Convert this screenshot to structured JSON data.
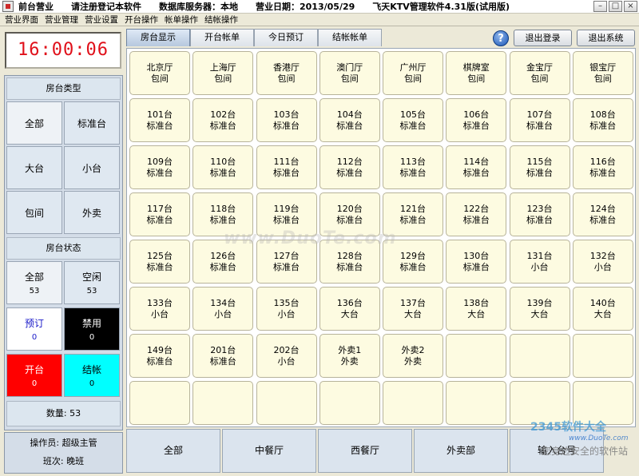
{
  "titlebar": {
    "segments": [
      "前台营业",
      "请注册登记本软件",
      "数据库服务器：本地",
      "营业日期：2013/05/29",
      "飞天KTV管理软件4.31版(试用版)"
    ]
  },
  "menu": [
    "营业界面",
    "营业管理",
    "营业设置",
    "开台操作",
    "帐单操作",
    "结帐操作"
  ],
  "clock": "16:00:06",
  "room_type": {
    "header": "房台类型",
    "buttons": [
      "全部",
      "标准台",
      "大台",
      "小台",
      "包间",
      "外卖"
    ]
  },
  "room_status": {
    "header": "房台状态",
    "buttons": [
      {
        "label": "全部",
        "count": "53"
      },
      {
        "label": "空闲",
        "count": "53"
      },
      {
        "label": "预订",
        "count": "0"
      },
      {
        "label": "禁用",
        "count": "0"
      },
      {
        "label": "开台",
        "count": "0"
      },
      {
        "label": "结帐",
        "count": "0"
      }
    ]
  },
  "quantity": "数量: 53",
  "operator": {
    "label": "操作员:",
    "value": "超级主管"
  },
  "shift": {
    "label": "班次:",
    "value": "晚班"
  },
  "tabs": [
    "房台显示",
    "开台帐单",
    "今日预订",
    "结帐帐单"
  ],
  "top_buttons": {
    "logout": "退出登录",
    "exit": "退出系统"
  },
  "rooms": [
    {
      "name": "北京厅",
      "type": "包间"
    },
    {
      "name": "上海厅",
      "type": "包间"
    },
    {
      "name": "香港厅",
      "type": "包间"
    },
    {
      "name": "澳门厅",
      "type": "包间"
    },
    {
      "name": "广州厅",
      "type": "包间"
    },
    {
      "name": "棋牌室",
      "type": "包间"
    },
    {
      "name": "金宝厅",
      "type": "包间"
    },
    {
      "name": "银宝厅",
      "type": "包间"
    },
    {
      "name": "101台",
      "type": "标准台"
    },
    {
      "name": "102台",
      "type": "标准台"
    },
    {
      "name": "103台",
      "type": "标准台"
    },
    {
      "name": "104台",
      "type": "标准台"
    },
    {
      "name": "105台",
      "type": "标准台"
    },
    {
      "name": "106台",
      "type": "标准台"
    },
    {
      "name": "107台",
      "type": "标准台"
    },
    {
      "name": "108台",
      "type": "标准台"
    },
    {
      "name": "109台",
      "type": "标准台"
    },
    {
      "name": "110台",
      "type": "标准台"
    },
    {
      "name": "111台",
      "type": "标准台"
    },
    {
      "name": "112台",
      "type": "标准台"
    },
    {
      "name": "113台",
      "type": "标准台"
    },
    {
      "name": "114台",
      "type": "标准台"
    },
    {
      "name": "115台",
      "type": "标准台"
    },
    {
      "name": "116台",
      "type": "标准台"
    },
    {
      "name": "117台",
      "type": "标准台"
    },
    {
      "name": "118台",
      "type": "标准台"
    },
    {
      "name": "119台",
      "type": "标准台"
    },
    {
      "name": "120台",
      "type": "标准台"
    },
    {
      "name": "121台",
      "type": "标准台"
    },
    {
      "name": "122台",
      "type": "标准台"
    },
    {
      "name": "123台",
      "type": "标准台"
    },
    {
      "name": "124台",
      "type": "标准台"
    },
    {
      "name": "125台",
      "type": "标准台"
    },
    {
      "name": "126台",
      "type": "标准台"
    },
    {
      "name": "127台",
      "type": "标准台"
    },
    {
      "name": "128台",
      "type": "标准台"
    },
    {
      "name": "129台",
      "type": "标准台"
    },
    {
      "name": "130台",
      "type": "标准台"
    },
    {
      "name": "131台",
      "type": "小台"
    },
    {
      "name": "132台",
      "type": "小台"
    },
    {
      "name": "133台",
      "type": "小台"
    },
    {
      "name": "134台",
      "type": "小台"
    },
    {
      "name": "135台",
      "type": "小台"
    },
    {
      "name": "136台",
      "type": "大台"
    },
    {
      "name": "137台",
      "type": "大台"
    },
    {
      "name": "138台",
      "type": "大台"
    },
    {
      "name": "139台",
      "type": "大台"
    },
    {
      "name": "140台",
      "type": "大台"
    },
    {
      "name": "149台",
      "type": "标准台"
    },
    {
      "name": "201台",
      "type": "标准台"
    },
    {
      "name": "202台",
      "type": "小台"
    },
    {
      "name": "外卖1",
      "type": "外卖"
    },
    {
      "name": "外卖2",
      "type": "外卖"
    }
  ],
  "bottom_buttons": [
    "全部",
    "中餐厅",
    "西餐厅",
    "外卖部",
    "输入台号"
  ],
  "watermark": "www.DuoTe.com",
  "watermark2": {
    "logo": "2345软件大全",
    "url": "www.DuoTe.com",
    "slogan": "您身边安全的软件站"
  }
}
